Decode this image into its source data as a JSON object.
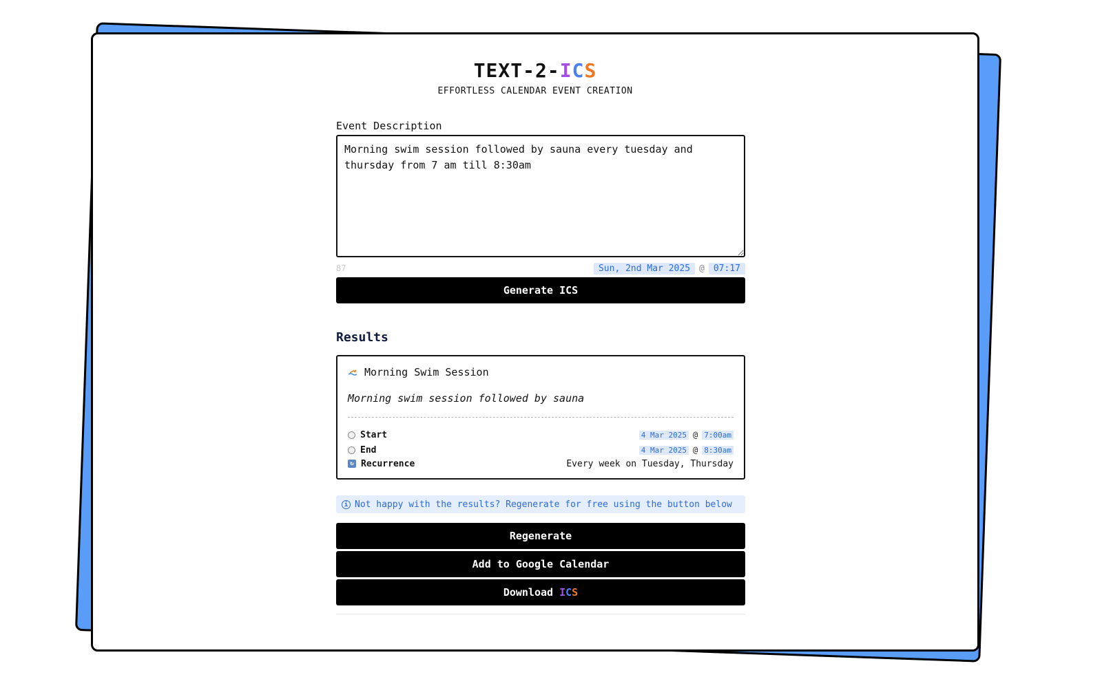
{
  "brand": {
    "title_prefix": "TEXT-2-",
    "title_i": "I",
    "title_c": "C",
    "title_s": "S",
    "subtitle": "EFFORTLESS CALENDAR EVENT CREATION"
  },
  "form": {
    "label": "Event Description",
    "value": "Morning swim session followed by sauna every tuesday and thursday from 7 am till 8:30am",
    "char_count": "87",
    "date_chip": "Sun, 2nd Mar 2025",
    "at": "@",
    "time_chip": "07:17",
    "generate_label": "Generate ICS"
  },
  "results": {
    "heading": "Results",
    "event_title": "Morning Swim Session",
    "event_description": "Morning swim session followed by sauna",
    "start": {
      "label": "Start",
      "date": "4 Mar 2025",
      "at": "@",
      "time": "7:00am"
    },
    "end": {
      "label": "End",
      "date": "4 Mar 2025",
      "at": "@",
      "time": "8:30am"
    },
    "recurrence": {
      "label": "Recurrence",
      "value": "Every week on Tuesday, Thursday"
    }
  },
  "notice": "Not happy with the results? Regenerate for free using the button below",
  "actions": {
    "regenerate": "Regenerate",
    "google": "Add to Google Calendar",
    "download_prefix": "Download ",
    "download_i": "I",
    "download_c": "C",
    "download_s": "S"
  },
  "colors": {
    "accent_blue": "#5a9df8",
    "chip_bg": "#dde9fb",
    "chip_text": "#2e6ad8",
    "ics_i": "#a34ee6",
    "ics_c": "#4a80f0",
    "ics_s": "#f07722"
  },
  "icons": {
    "event": "swimmer-icon",
    "start": "clock-icon",
    "end": "clock-icon",
    "recurrence": "repeat-icon",
    "notice": "info-icon"
  }
}
